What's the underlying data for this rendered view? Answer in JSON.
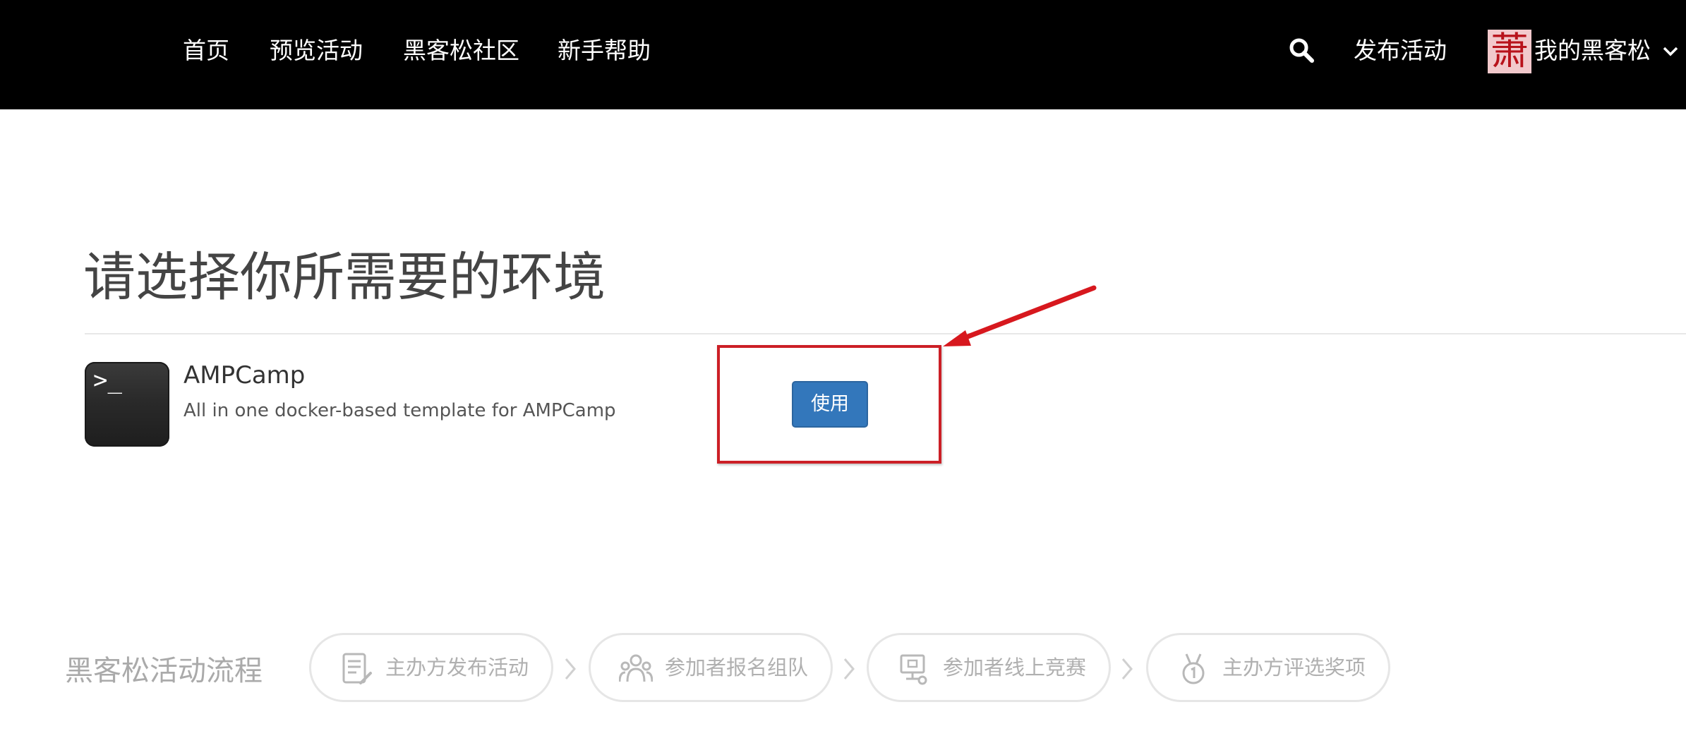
{
  "nav": {
    "links": [
      "首页",
      "预览活动",
      "黑客松社区",
      "新手帮助"
    ],
    "publish_label": "发布活动",
    "user_label": "我的黑客松",
    "avatar_char": "萧"
  },
  "main": {
    "title": "请选择你所需要的环境",
    "environment": {
      "name": "AMPCamp",
      "description": "All in one docker-based template for AMPCamp",
      "icon_prompt": ">_",
      "use_button_label": "使用"
    }
  },
  "flow": {
    "title": "黑客松活动流程",
    "steps": [
      "主办方发布活动",
      "参加者报名组队",
      "参加者线上竞赛",
      "主办方评选奖项"
    ]
  },
  "colors": {
    "navbar_bg": "#000000",
    "button_bg": "#3377bb",
    "highlight": "#cc1f26",
    "flow_text": "#aaaaaa"
  },
  "icons": {
    "search": "search-icon",
    "chevron": "chevron-down-icon",
    "terminal": "terminal-icon",
    "steps": [
      "document-icon",
      "group-icon",
      "computer-icon",
      "medal-icon"
    ],
    "annotation": "annotation-arrow-icon"
  }
}
